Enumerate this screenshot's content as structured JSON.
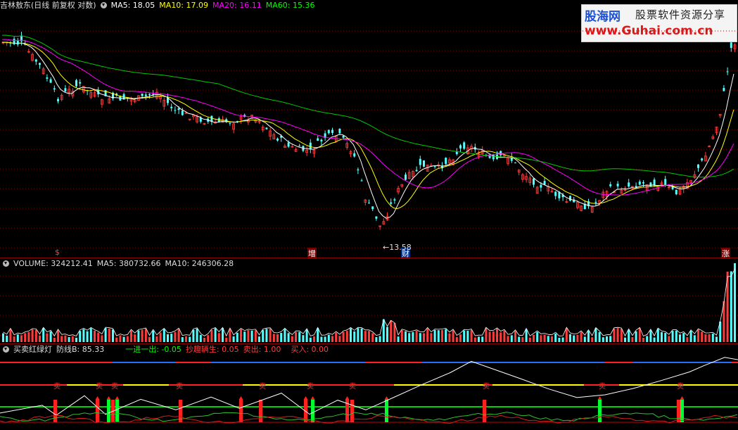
{
  "price_panel": {
    "title": "吉林敖东(日线 前复权 对数)",
    "ma5": "MA5: 18.05",
    "ma10": "MA10: 17.09",
    "ma20": "MA20: 16.11",
    "ma60": "MA60: 15.36",
    "low_label": "←13.58",
    "markers": {
      "left": "$",
      "mid1": "增",
      "mid2": "财",
      "right": "涨"
    }
  },
  "volume_panel": {
    "vol": "VOLUME: 324212.41",
    "ma5": "MA5: 380732.66",
    "ma10": "MA10: 246306.28"
  },
  "indicator_panel": {
    "name": "买卖红绿灯",
    "fangxian": "防线B: 85.33",
    "yijin": "一进一出: -0.05",
    "chaoqu": "抄趣辆生: 0.05",
    "maichu": "卖出: 1.00",
    "mairu": "买入: 0.00",
    "sell_label": "卖"
  },
  "logo": {
    "name": "股海网",
    "tagline": "股票软件资源分享",
    "url": "www.Guhai.com.cn"
  },
  "colors": {
    "bg": "#000000",
    "up": "#ff3c3c",
    "down": "#54ffff",
    "ma5": "#ffffff",
    "ma10": "#ffff00",
    "ma20": "#ff00ff",
    "ma60": "#00c800",
    "grid": "#8a0000"
  }
}
